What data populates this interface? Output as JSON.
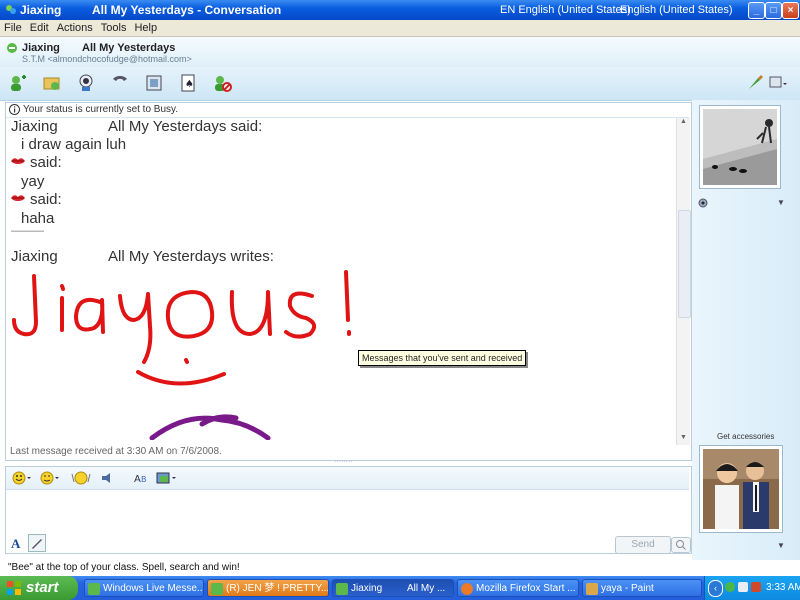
{
  "window": {
    "app_name": "Jiaxing",
    "title": "All My Yesterdays - Conversation",
    "lang_indicator": "EN English (United States)",
    "lang_indicator2": "English (United States)"
  },
  "menu": [
    "File",
    "Edit",
    "Actions",
    "Tools",
    "Help"
  ],
  "contact": {
    "name": "Jiaxing",
    "personal_message": "All My Yesterdays",
    "email_line": "S.T.M <almondchocofudge@hotmail.com>"
  },
  "toolbar_icons": [
    "invite-icon",
    "share-files-icon",
    "video-call-icon",
    "call-icon",
    "activities-icon",
    "games-icon",
    "block-icon",
    "paint-brush-icon",
    "display-options-icon"
  ],
  "status_bar": "Your status is currently set to Busy.",
  "conversation": {
    "line1_name": "Jiaxing",
    "line1_msg_name": "All My Yesterdays said:",
    "line1_text": "i draw again luh",
    "line2_said": "said:",
    "line2_text": "yay",
    "line3_said": "said:",
    "line3_text": "haha",
    "divider": "———",
    "ink_name": "Jiaxing",
    "ink_header": "All My Yesterdays writes:",
    "last_message": "Last message received at 3:30 AM on 7/6/2008."
  },
  "tooltip": "Messages that you've sent and received",
  "compose": {
    "send_label": "Send"
  },
  "right_panel": {
    "get_accessories": "Get accessories"
  },
  "tip": "\"Bee\" at the top of your class.  Spell, search and win!",
  "taskbar": {
    "start": "start",
    "tasks": [
      "Windows Live Messe...",
      "(R) JEN 梦 ! PRETTY...",
      "Jiaxing",
      "All My ...",
      "Mozilla Firefox Start ...",
      "yaya - Paint"
    ],
    "clock": "3:33 AM"
  },
  "colors": {
    "ink_red": "#e01414",
    "ink_purple": "#7a1a8a",
    "titlebar_blue": "#0a5ee0"
  }
}
